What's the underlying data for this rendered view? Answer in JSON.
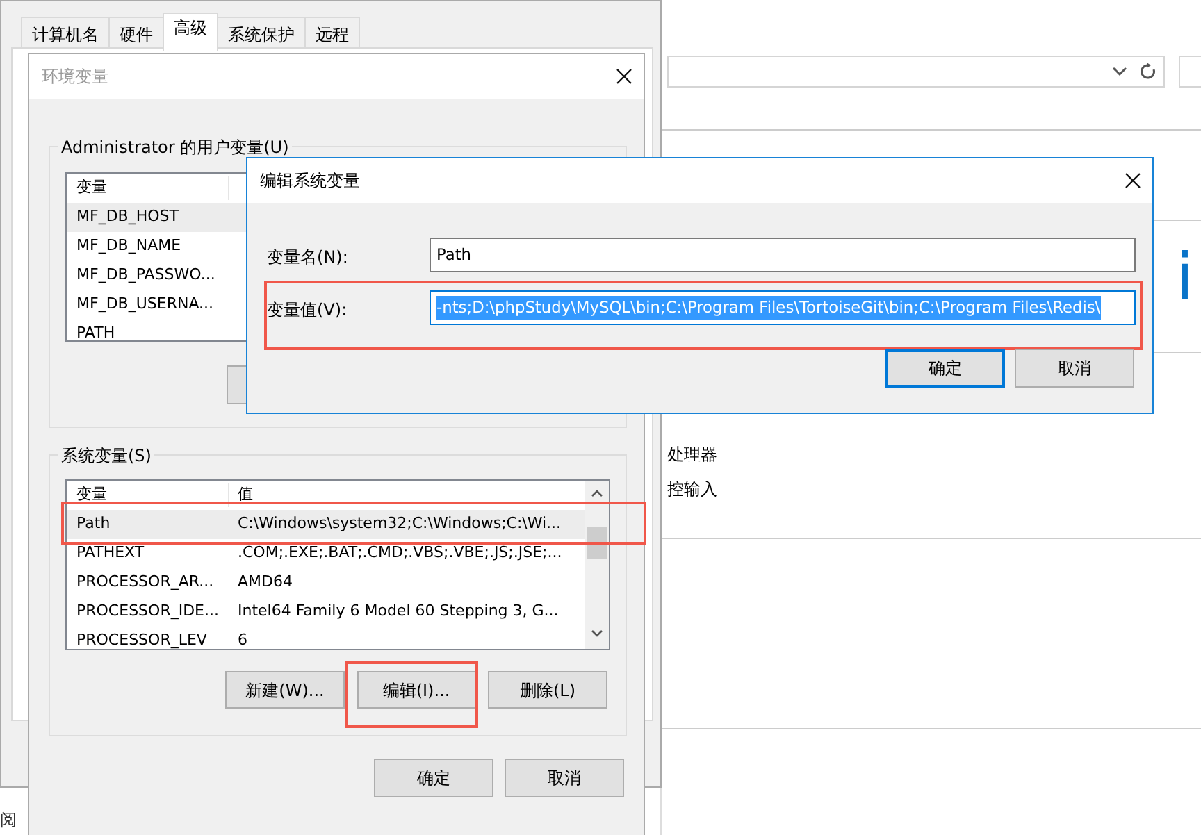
{
  "background_window": {
    "heading_fragment": "i",
    "items": [
      "处理器",
      "控输入"
    ],
    "side_text": "阅"
  },
  "system_properties": {
    "tabs": [
      {
        "label": "计算机名",
        "selected": false
      },
      {
        "label": "硬件",
        "selected": false
      },
      {
        "label": "高级",
        "selected": true
      },
      {
        "label": "系统保护",
        "selected": false
      },
      {
        "label": "远程",
        "selected": false
      }
    ]
  },
  "env_dialog": {
    "title": "环境变量",
    "active": false,
    "user_group": {
      "title": "Administrator 的用户变量(U)",
      "columns": [
        "变量"
      ],
      "rows": [
        {
          "name": "MF_DB_HOST",
          "selected": true,
          "highlighted": false
        },
        {
          "name": "MF_DB_NAME",
          "selected": false,
          "highlighted": false
        },
        {
          "name": "MF_DB_PASSWO...",
          "selected": false,
          "highlighted": false
        },
        {
          "name": "MF_DB_USERNA...",
          "selected": false,
          "highlighted": false
        },
        {
          "name": "PATH",
          "selected": false,
          "highlighted": false
        }
      ]
    },
    "system_group": {
      "title": "系统变量(S)",
      "columns": [
        "变量",
        "值"
      ],
      "rows": [
        {
          "name": "Path",
          "value": "C:\\Windows\\system32;C:\\Windows;C:\\Wi...",
          "selected": true,
          "highlighted": true
        },
        {
          "name": "PATHEXT",
          "value": ".COM;.EXE;.BAT;.CMD;.VBS;.VBE;.JS;.JSE;...",
          "selected": false,
          "highlighted": false
        },
        {
          "name": "PROCESSOR_AR...",
          "value": "AMD64",
          "selected": false,
          "highlighted": false
        },
        {
          "name": "PROCESSOR_IDE...",
          "value": "Intel64 Family 6 Model 60 Stepping 3, G...",
          "selected": false,
          "highlighted": false
        },
        {
          "name": "PROCESSOR_LEV",
          "value": "6",
          "selected": false,
          "highlighted": false
        }
      ],
      "buttons": [
        {
          "label": "新建(W)...",
          "highlighted": false
        },
        {
          "label": "编辑(I)...",
          "highlighted": true
        },
        {
          "label": "删除(L)",
          "highlighted": false
        }
      ]
    },
    "buttons": [
      {
        "label": "确定"
      },
      {
        "label": "取消"
      }
    ]
  },
  "edit_dialog": {
    "title": "编辑系统变量",
    "fields": [
      {
        "label": "变量名(N):",
        "value": "Path",
        "text_selected": false,
        "highlighted": false
      },
      {
        "label": "变量值(V):",
        "value": "-nts;D:\\phpStudy\\MySQL\\bin;C:\\Program Files\\TortoiseGit\\bin;C:\\Program Files\\Redis\\",
        "text_selected": true,
        "highlighted": true
      }
    ],
    "buttons": [
      {
        "label": "确定",
        "default": true
      },
      {
        "label": "取消",
        "default": false
      }
    ]
  }
}
